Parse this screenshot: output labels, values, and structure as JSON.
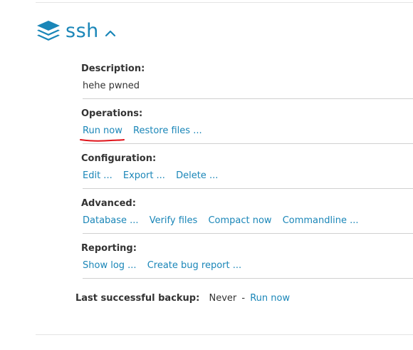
{
  "header": {
    "title": "ssh",
    "icon": "stack-layers-icon",
    "toggle_icon": "chevron-up-icon"
  },
  "description": {
    "label": "Description:",
    "value": "hehe pwned"
  },
  "operations": {
    "label": "Operations:",
    "run_now": "Run now",
    "restore_files": "Restore files ..."
  },
  "configuration": {
    "label": "Configuration:",
    "edit": "Edit ...",
    "export": "Export ...",
    "delete": "Delete ..."
  },
  "advanced": {
    "label": "Advanced:",
    "database": "Database ...",
    "verify_files": "Verify files",
    "compact_now": "Compact now",
    "commandline": "Commandline ..."
  },
  "reporting": {
    "label": "Reporting:",
    "show_log": "Show log ...",
    "create_bug_report": "Create bug report ..."
  },
  "last_backup": {
    "label": "Last successful backup:",
    "value": "Never",
    "separator": "-",
    "run_now": "Run now"
  },
  "colors": {
    "accent": "#1a86b8",
    "annotation_underline": "#e0141b",
    "text": "#333333"
  }
}
